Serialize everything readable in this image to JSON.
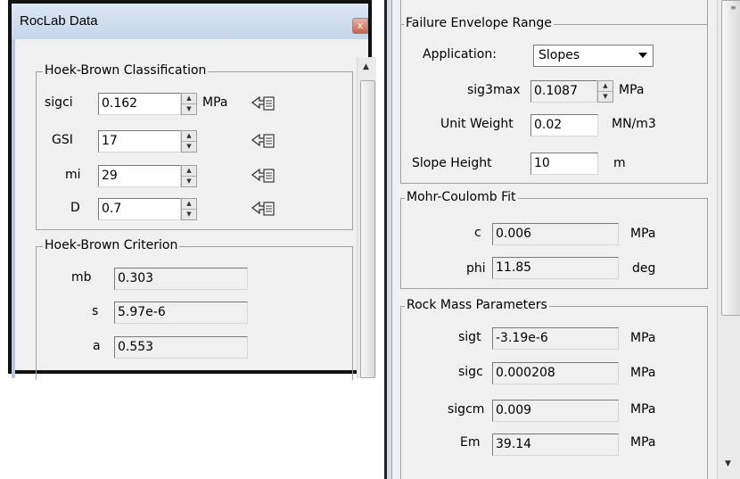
{
  "left_window": {
    "title": "RocLab Data",
    "close_glyph": "x",
    "hoek_brown_classification": {
      "label": "Hoek-Brown Classification",
      "rows": [
        {
          "label": "sigci",
          "value": "0.162",
          "unit": "MPa"
        },
        {
          "label": "GSI",
          "value": "17",
          "unit": ""
        },
        {
          "label": "mi",
          "value": "29",
          "unit": ""
        },
        {
          "label": "D",
          "value": "0.7",
          "unit": ""
        }
      ]
    },
    "hoek_brown_criterion": {
      "label": "Hoek-Brown Criterion",
      "rows": [
        {
          "label": "mb",
          "value": "0.303"
        },
        {
          "label": "s",
          "value": "5.97e-6"
        },
        {
          "label": "a",
          "value": "0.553"
        }
      ]
    }
  },
  "right_window": {
    "failure_envelope_range": {
      "label": "Failure Envelope Range",
      "application_label": "Application:",
      "application_value": "Slopes",
      "sig3max_label": "sig3max",
      "sig3max_value": "0.1087",
      "sig3max_unit": "MPa",
      "unit_weight_label": "Unit Weight",
      "unit_weight_value": "0.02",
      "unit_weight_unit": "MN/m3",
      "slope_height_label": "Slope Height",
      "slope_height_value": "10",
      "slope_height_unit": "m"
    },
    "mohr_coulomb_fit": {
      "label": "Mohr-Coulomb Fit",
      "rows": [
        {
          "label": "c",
          "value": "0.006",
          "unit": "MPa"
        },
        {
          "label": "phi",
          "value": "11.85",
          "unit": "deg"
        }
      ]
    },
    "rock_mass_parameters": {
      "label": "Rock Mass Parameters",
      "rows": [
        {
          "label": "sigt",
          "value": "-3.19e-6",
          "unit": "MPa"
        },
        {
          "label": "sigc",
          "value": "0.000208",
          "unit": "MPa"
        },
        {
          "label": "sigcm",
          "value": "0.009",
          "unit": "MPa"
        },
        {
          "label": "Em",
          "value": "39.14",
          "unit": "MPa"
        }
      ]
    }
  },
  "icons": {
    "pick": "pick-value-icon",
    "spin_up": "▲",
    "spin_down": "▼",
    "scroll_up": "▲",
    "scroll_down": "▼",
    "grip": "≡"
  }
}
